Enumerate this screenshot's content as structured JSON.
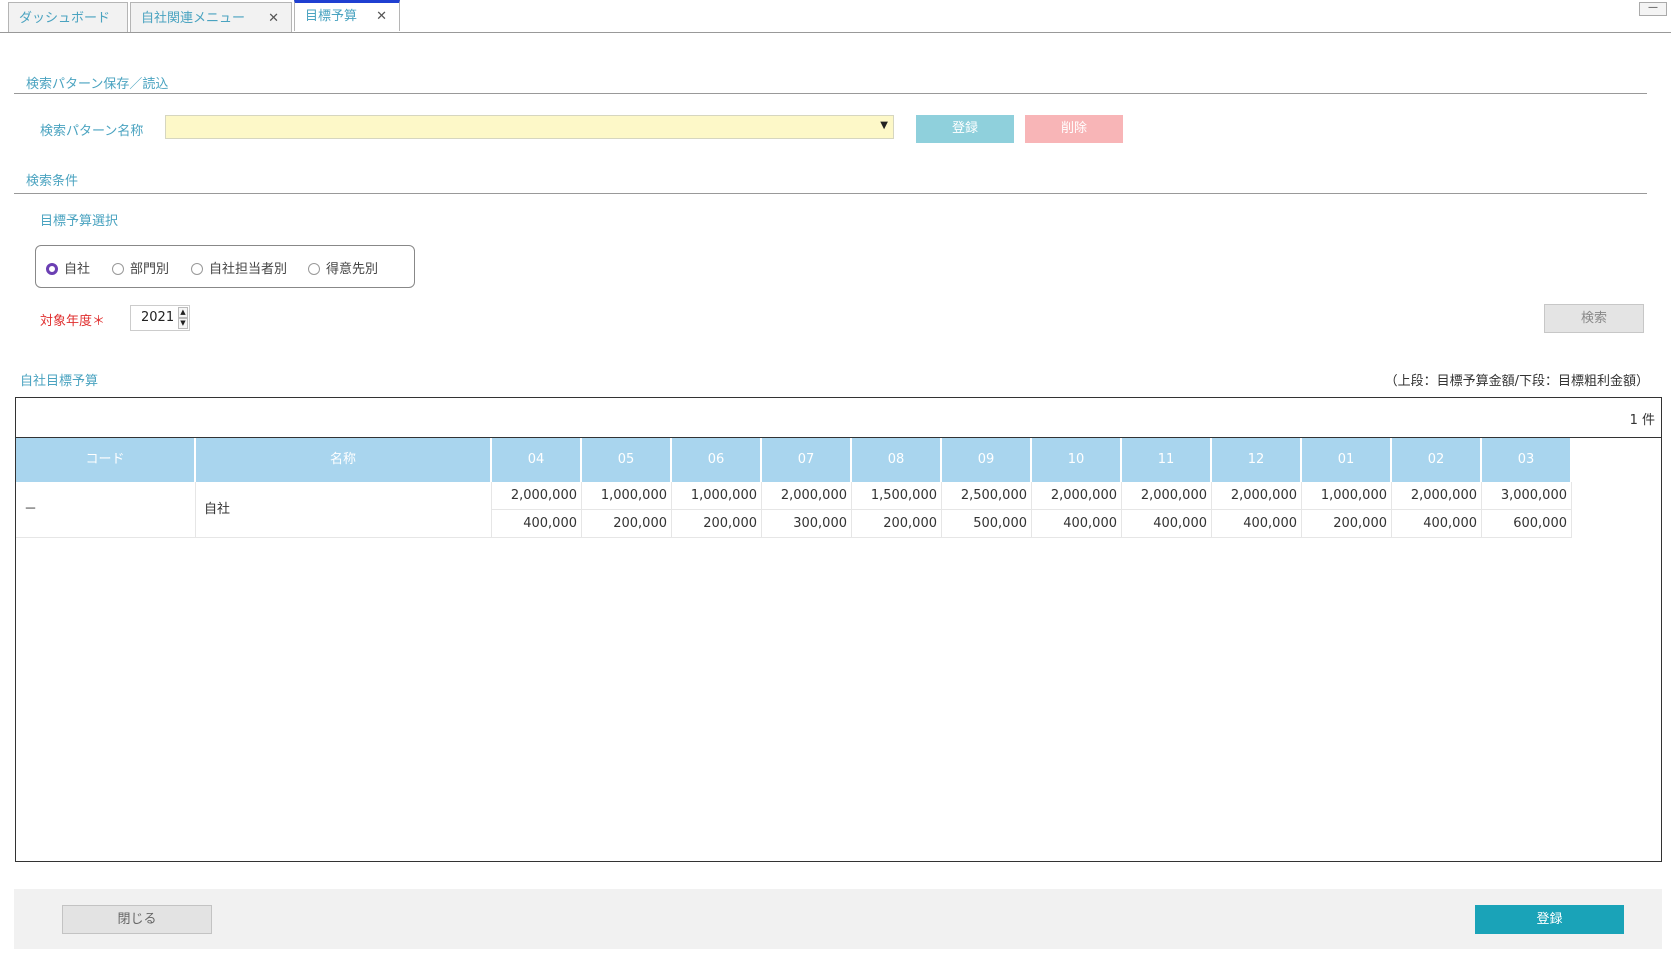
{
  "tabs": [
    {
      "label": "ダッシュボード",
      "closable": false
    },
    {
      "label": "自社関連メニュー",
      "closable": true
    },
    {
      "label": "目標予算",
      "closable": true,
      "active": true
    }
  ],
  "window": {
    "minimize": "—"
  },
  "pattern_section": {
    "title": "検索パターン保存／読込",
    "name_label": "検索パターン名称",
    "selected_value": "",
    "register_label": "登録",
    "delete_label": "削除"
  },
  "criteria_section": {
    "title": "検索条件",
    "budget_select_label": "目標予算選択",
    "radio_options": [
      "自社",
      "部門別",
      "自社担当者別",
      "得意先別"
    ],
    "selected_option": "自社",
    "year_label": "対象年度＊",
    "year_value": "2021",
    "search_label": "検索"
  },
  "grid_section": {
    "title": "自社目標予算",
    "note": "（上段：目標予算金額/下段：目標粗利金額）",
    "count_text": "1 件",
    "columns": [
      "コード",
      "名称",
      "04",
      "05",
      "06",
      "07",
      "08",
      "09",
      "10",
      "11",
      "12",
      "01",
      "02",
      "03"
    ],
    "rows": [
      {
        "code": "－",
        "name": "自社",
        "budget": [
          "2,000,000",
          "1,000,000",
          "1,000,000",
          "2,000,000",
          "1,500,000",
          "2,500,000",
          "2,000,000",
          "2,000,000",
          "2,000,000",
          "1,000,000",
          "2,000,000",
          "3,000,000"
        ],
        "profit": [
          "400,000",
          "200,000",
          "200,000",
          "300,000",
          "200,000",
          "500,000",
          "400,000",
          "400,000",
          "400,000",
          "200,000",
          "400,000",
          "600,000"
        ]
      }
    ]
  },
  "footer": {
    "close_label": "閉じる",
    "register_label": "登録"
  },
  "colors": {
    "accent_text": "#4aa3c0",
    "header_bg": "#a9d5ee",
    "register_bottom": "#1aa3b8",
    "required": "#e03030"
  }
}
